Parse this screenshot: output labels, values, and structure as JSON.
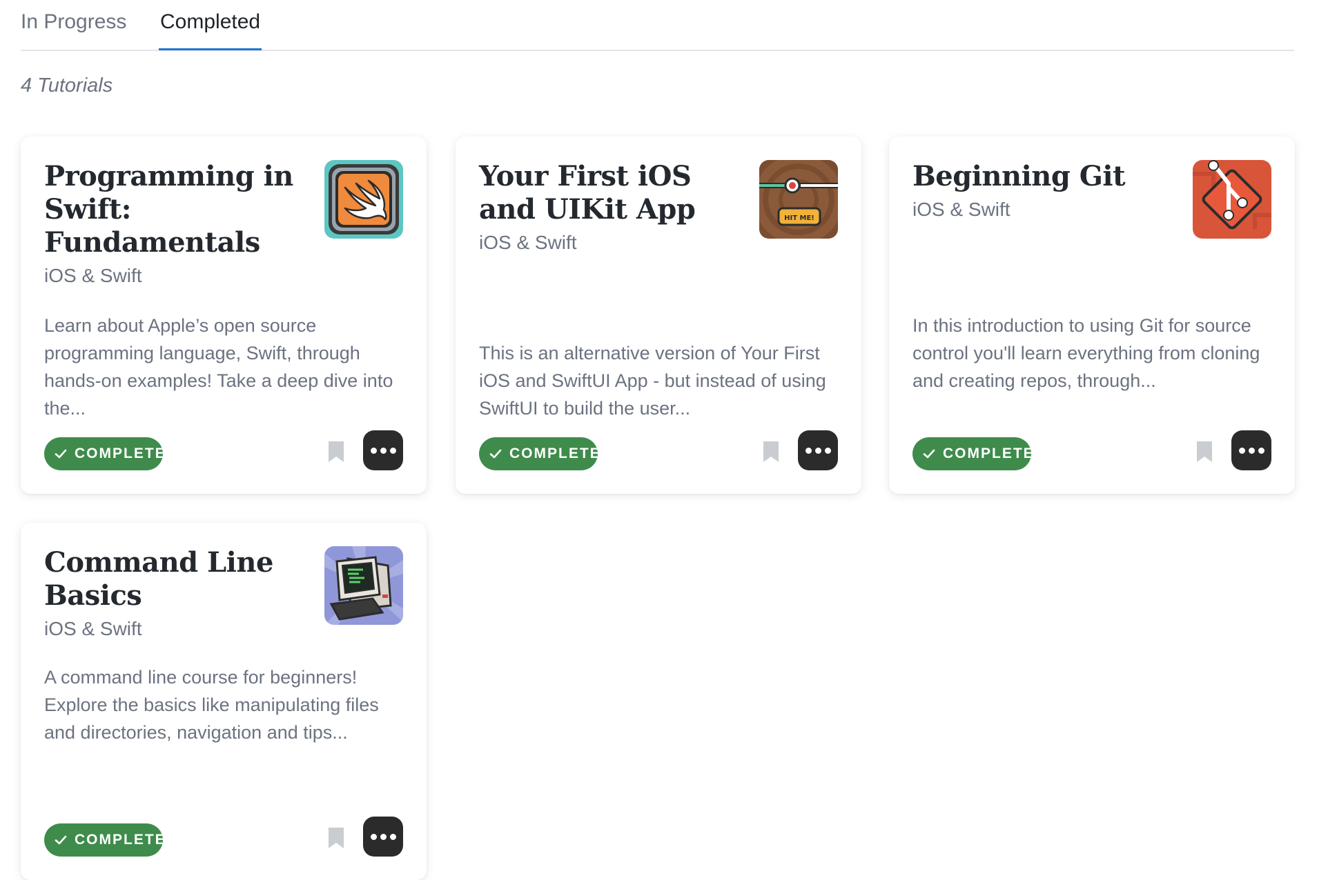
{
  "tabs": {
    "in_progress": "In Progress",
    "completed": "Completed",
    "active": "completed"
  },
  "tutorials_count_label": "4 Tutorials",
  "badge_label": "COMPLETE",
  "colors": {
    "accent_tab": "#1f75d8",
    "badge_green": "#3f8b4c",
    "more_button": "#2b2b2b"
  },
  "cards": [
    {
      "title": "Programming in Swift: Fundamentals",
      "domain": "iOS & Swift",
      "description": "Learn about Apple’s open source programming language, Swift, through hands-on examples! Take a deep dive into the...",
      "status": "COMPLETE",
      "icon": "swift-bird-icon"
    },
    {
      "title": "Your First iOS and UIKit App",
      "domain": "iOS & Swift",
      "description": "This is an alternative version of Your First iOS and SwiftUI App - but instead of using SwiftUI to build the user...",
      "status": "COMPLETE",
      "icon": "hit-me-slider-icon",
      "icon_text": "HIT ME!"
    },
    {
      "title": "Beginning Git",
      "domain": "iOS & Swift",
      "description": "In this introduction to using Git for source control you'll learn everything from cloning and creating repos, through...",
      "status": "COMPLETE",
      "icon": "git-logo-icon"
    },
    {
      "title": "Command Line Basics",
      "domain": "iOS & Swift",
      "description": "A command line course for beginners! Explore the basics like manipulating files and directories, navigation and tips...",
      "status": "COMPLETE",
      "icon": "terminal-computer-icon"
    }
  ]
}
